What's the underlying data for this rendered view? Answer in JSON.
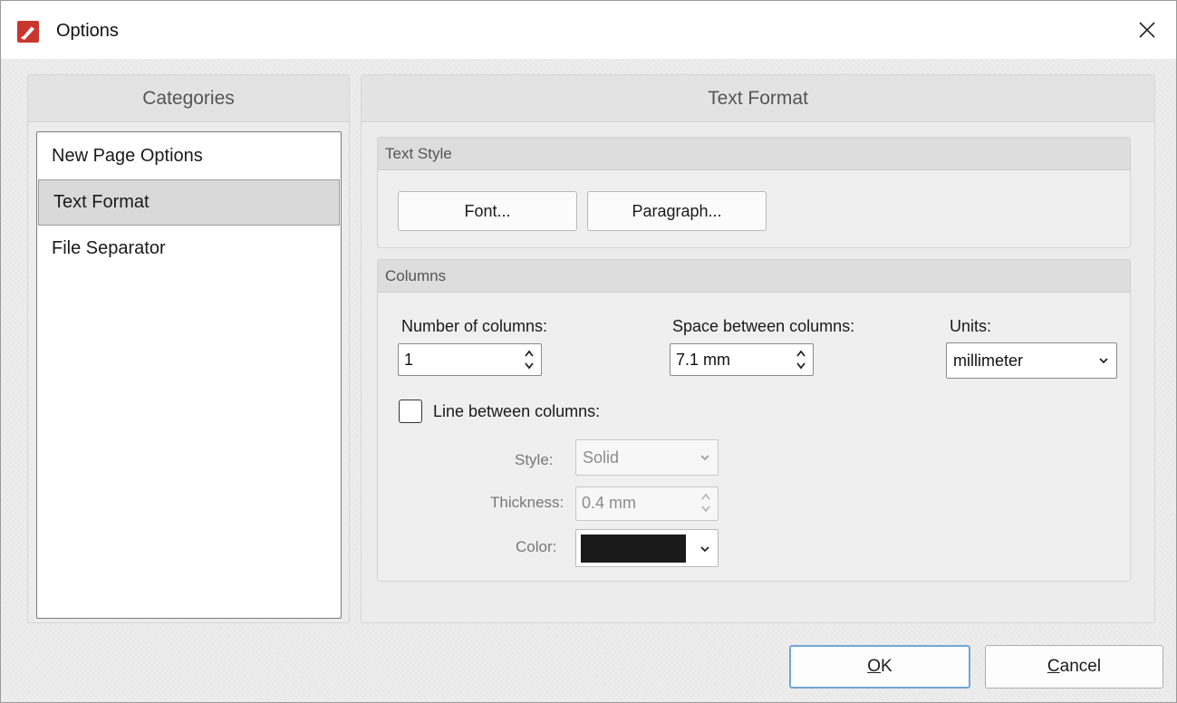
{
  "window": {
    "title": "Options"
  },
  "categories": {
    "header": "Categories",
    "items": [
      {
        "label": "New Page Options",
        "selected": false
      },
      {
        "label": "Text Format",
        "selected": true
      },
      {
        "label": "File Separator",
        "selected": false
      }
    ]
  },
  "content": {
    "header": "Text Format",
    "text_style": {
      "title": "Text Style",
      "font_button": "Font...",
      "paragraph_button": "Paragraph..."
    },
    "columns": {
      "title": "Columns",
      "number_label": "Number of columns:",
      "number_value": "1",
      "space_label": "Space between columns:",
      "space_value": "7.1 mm",
      "units_label": "Units:",
      "units_value": "millimeter",
      "line_between_label": "Line between columns:",
      "line_between_checked": false,
      "style_label": "Style:",
      "style_value": "Solid",
      "thickness_label": "Thickness:",
      "thickness_value": "0.4 mm",
      "color_label": "Color:",
      "color_value": "#1a1a1a"
    }
  },
  "footer": {
    "ok_mnemonic": "O",
    "ok_rest": "K",
    "cancel_mnemonic": "C",
    "cancel_rest": "ancel"
  },
  "colors": {
    "app_icon": "#c8372d",
    "default_button_border": "#6fa6d8",
    "selected_category": "#d9d9d9"
  }
}
